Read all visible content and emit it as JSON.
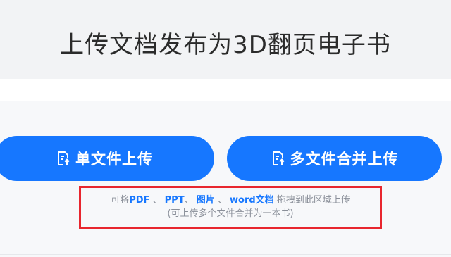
{
  "header": {
    "title": "上传文档发布为3D翻页电子书"
  },
  "buttons": {
    "single_upload": "单文件上传",
    "multi_merge_upload": "多文件合并上传"
  },
  "drop_zone": {
    "prefix": "可将",
    "pdf": "PDF",
    "sep1": " 、 ",
    "ppt": "PPT",
    "sep2": "、 ",
    "image": "图片",
    "sep3": " 、 ",
    "word": "word文档",
    "suffix": " 拖拽到此区域上传",
    "hint": "(可上传多个文件合并为一本书)"
  },
  "colors": {
    "accent": "#1677ff",
    "highlight_border": "#e8262e",
    "header_bg": "#f2f3f5"
  },
  "icons": {
    "upload": "upload-doc-icon"
  }
}
